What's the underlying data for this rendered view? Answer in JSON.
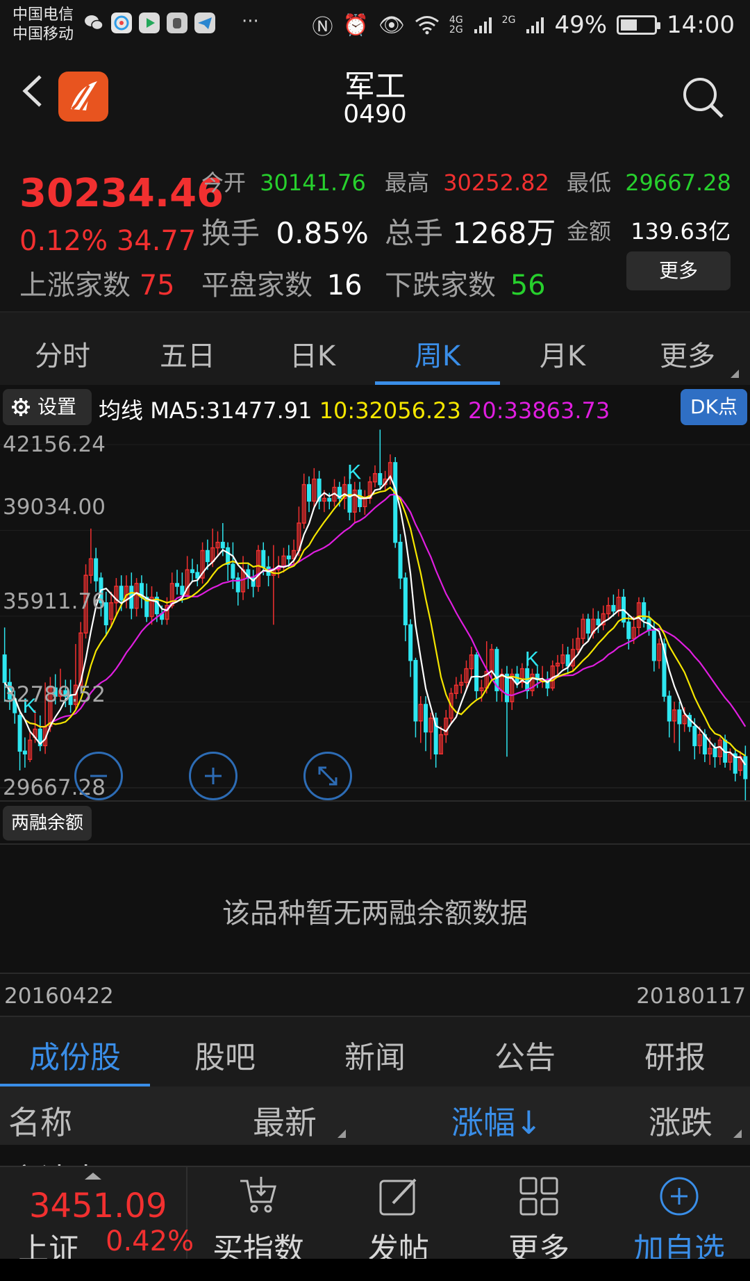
{
  "status_bar": {
    "carrier1": "中国电信",
    "carrier2": "中国移动",
    "net_label_1": "4G",
    "net_label_2": "2G",
    "net_label_3": "2G",
    "battery": "49%",
    "battery_level": 0.49,
    "time": "14:00",
    "more_dots": "···"
  },
  "header": {
    "title": "军工",
    "code": "0490"
  },
  "quote": {
    "price": "30234.46",
    "change_pct": "0.12%",
    "change_val": "34.77",
    "open_label": "今开",
    "open": "30141.76",
    "high_label": "最高",
    "high": "30252.82",
    "low_label": "最低",
    "low": "29667.28",
    "turnover_label": "换手",
    "turnover": "0.85%",
    "volume_label": "总手",
    "volume": "1268万",
    "amount_label": "金额",
    "amount": "139.63亿",
    "rising_label": "上涨家数",
    "rising": "75",
    "flat_label": "平盘家数",
    "flat": "16",
    "falling_label": "下跌家数",
    "falling": "56",
    "more_button": "更多"
  },
  "period_tabs": [
    "分时",
    "五日",
    "日K",
    "周K",
    "月K",
    "更多"
  ],
  "active_period": "周K",
  "ma_bar": {
    "settings": "设置",
    "ma_label": "均线",
    "ma5": "MA5:31477.91",
    "ma10": "10:32056.23",
    "ma20": "20:33863.73",
    "dk_button": "DK点"
  },
  "colors": {
    "up": "#f23030",
    "down": "#27d02d",
    "candle_down": "#2ee6f0",
    "ma5": "#ffffff",
    "ma10": "#f5e600",
    "ma20": "#e01ee0",
    "accent": "#3a8ee8"
  },
  "chart": {
    "y_labels": [
      "42156.24",
      "39034.00",
      "35911.76",
      "32789.52",
      "29667.28"
    ],
    "k_marker": "K",
    "signal_weeks": [
      3,
      67,
      102
    ],
    "candles": [
      [
        34500,
        33500,
        35500,
        32800
      ],
      [
        33500,
        32900,
        34000,
        32500
      ],
      [
        32900,
        32400,
        33200,
        32000
      ],
      [
        32300,
        31000,
        32500,
        30300
      ],
      [
        31000,
        30900,
        31500,
        30400
      ],
      [
        30700,
        31400,
        31700,
        30600
      ],
      [
        31500,
        31800,
        32500,
        31300
      ],
      [
        31800,
        31200,
        32300,
        31000
      ],
      [
        31200,
        31900,
        33500,
        30900
      ],
      [
        31900,
        33300,
        33700,
        31700
      ],
      [
        33300,
        33000,
        33800,
        32700
      ],
      [
        33000,
        33200,
        34000,
        32800
      ],
      [
        33200,
        33000,
        33600,
        32600
      ],
      [
        33000,
        32700,
        33600,
        32400
      ],
      [
        32700,
        33400,
        34900,
        32500
      ],
      [
        33400,
        35300,
        35700,
        33200
      ],
      [
        35300,
        37400,
        37800,
        35100
      ],
      [
        37400,
        38000,
        39100,
        37100
      ],
      [
        38000,
        37200,
        38400,
        36800
      ],
      [
        37300,
        36400,
        37500,
        35900
      ],
      [
        36400,
        35600,
        36800,
        35200
      ],
      [
        35800,
        36400,
        36800,
        35500
      ],
      [
        36400,
        37000,
        37300,
        35900
      ],
      [
        37000,
        36500,
        37400,
        36100
      ],
      [
        36500,
        37000,
        37400,
        36200
      ],
      [
        37000,
        36200,
        37500,
        35800
      ],
      [
        36200,
        37100,
        37300,
        35900
      ],
      [
        37100,
        36600,
        37400,
        36200
      ],
      [
        36600,
        35900,
        37100,
        35700
      ],
      [
        35900,
        36600,
        37000,
        35600
      ],
      [
        36600,
        36000,
        36800,
        35700
      ],
      [
        36000,
        35800,
        36300,
        35600
      ],
      [
        35800,
        36300,
        36600,
        35600
      ],
      [
        36300,
        37100,
        37500,
        36200
      ],
      [
        37100,
        37000,
        37600,
        36700
      ],
      [
        37000,
        36700,
        37500,
        36400
      ],
      [
        36700,
        37600,
        38100,
        36600
      ],
      [
        37600,
        37500,
        38000,
        37200
      ],
      [
        37500,
        37300,
        37800,
        37000
      ],
      [
        37300,
        38300,
        38600,
        37100
      ],
      [
        38300,
        37900,
        38700,
        37600
      ],
      [
        37900,
        38400,
        39100,
        37700
      ],
      [
        38400,
        38600,
        39000,
        38100
      ],
      [
        38600,
        38400,
        39300,
        38100
      ],
      [
        38400,
        37800,
        38600,
        37200
      ],
      [
        37800,
        37300,
        38600,
        36900
      ],
      [
        37300,
        36800,
        37500,
        36300
      ],
      [
        36800,
        37600,
        38100,
        36500
      ],
      [
        37600,
        37300,
        37800,
        36900
      ],
      [
        37300,
        37000,
        37600,
        36600
      ],
      [
        37000,
        38300,
        38500,
        36800
      ],
      [
        38300,
        37700,
        38600,
        37400
      ],
      [
        37700,
        37400,
        38100,
        37000
      ],
      [
        37400,
        37600,
        38500,
        35600
      ],
      [
        37600,
        37700,
        38100,
        37300
      ],
      [
        37700,
        38100,
        38400,
        37500
      ],
      [
        38100,
        38000,
        38500,
        37700
      ],
      [
        38000,
        38300,
        38700,
        37800
      ],
      [
        38300,
        39300,
        39900,
        38100
      ],
      [
        39300,
        40700,
        41100,
        39100
      ],
      [
        40700,
        40100,
        41000,
        39700
      ],
      [
        40100,
        40900,
        41300,
        39800
      ],
      [
        40900,
        40100,
        41200,
        39800
      ],
      [
        40100,
        40200,
        40500,
        39700
      ],
      [
        40200,
        40100,
        40400,
        39800
      ],
      [
        40100,
        40600,
        40900,
        39900
      ],
      [
        40600,
        40200,
        40800,
        39900
      ],
      [
        40200,
        40700,
        41000,
        39800
      ],
      [
        40700,
        39700,
        41000,
        39400
      ],
      [
        39700,
        40500,
        40800,
        39300
      ],
      [
        40500,
        39900,
        40800,
        39700
      ],
      [
        39900,
        40200,
        40500,
        39600
      ],
      [
        40200,
        40800,
        41000,
        40000
      ],
      [
        40800,
        41100,
        41400,
        40600
      ],
      [
        41100,
        40700,
        42700,
        40500
      ],
      [
        40700,
        40900,
        41200,
        40500
      ],
      [
        40900,
        41500,
        41800,
        40700
      ],
      [
        41500,
        38600,
        41700,
        38400
      ],
      [
        38600,
        37300,
        38900,
        36900
      ],
      [
        37300,
        35600,
        37500,
        35000
      ],
      [
        35600,
        34300,
        35800,
        33700
      ],
      [
        34300,
        32100,
        34400,
        31500
      ],
      [
        32100,
        32700,
        33000,
        31300
      ],
      [
        32700,
        31700,
        33000,
        31000
      ],
      [
        31700,
        32200,
        32400,
        30700
      ],
      [
        32200,
        30900,
        32400,
        30400
      ],
      [
        30900,
        31600,
        31900,
        30900
      ],
      [
        31600,
        32200,
        32500,
        31300
      ],
      [
        32200,
        33100,
        33300,
        32000
      ],
      [
        33100,
        33400,
        33700,
        32900
      ],
      [
        33400,
        33500,
        33800,
        33100
      ],
      [
        33500,
        34000,
        34300,
        33200
      ],
      [
        34000,
        34500,
        34800,
        33700
      ],
      [
        34500,
        33200,
        34600,
        32900
      ],
      [
        33200,
        33300,
        33600,
        32800
      ],
      [
        33300,
        33900,
        35000,
        33100
      ],
      [
        33900,
        34700,
        34900,
        33600
      ],
      [
        34700,
        33200,
        34800,
        32800
      ],
      [
        33200,
        33800,
        34000,
        32800
      ],
      [
        33800,
        32800,
        34100,
        30800
      ],
      [
        32800,
        33800,
        34000,
        32500
      ],
      [
        33800,
        33500,
        34100,
        33300
      ],
      [
        33500,
        34000,
        34200,
        33300
      ],
      [
        34000,
        33200,
        34400,
        32900
      ],
      [
        33200,
        33800,
        34000,
        33000
      ],
      [
        33800,
        33600,
        34100,
        33300
      ],
      [
        33600,
        33600,
        34100,
        33300
      ],
      [
        33600,
        33300,
        33900,
        33000
      ],
      [
        33300,
        34100,
        34300,
        33200
      ],
      [
        34100,
        34200,
        34500,
        33800
      ],
      [
        34200,
        34500,
        34900,
        34000
      ],
      [
        34500,
        34100,
        34800,
        33800
      ],
      [
        34100,
        34700,
        35100,
        33900
      ],
      [
        34700,
        35100,
        35500,
        34500
      ],
      [
        35100,
        35800,
        36000,
        34900
      ],
      [
        35800,
        35300,
        36000,
        35000
      ],
      [
        35300,
        35800,
        36200,
        35100
      ],
      [
        35800,
        35600,
        36100,
        35300
      ],
      [
        35600,
        36000,
        36300,
        35400
      ],
      [
        36000,
        36300,
        36600,
        35800
      ],
      [
        36300,
        36100,
        36700,
        35900
      ],
      [
        36100,
        36600,
        36900,
        35900
      ],
      [
        36600,
        35700,
        36900,
        35500
      ],
      [
        35700,
        35100,
        36000,
        34700
      ],
      [
        35100,
        35500,
        35900,
        34900
      ],
      [
        35500,
        36400,
        36600,
        35200
      ],
      [
        36400,
        35800,
        36600,
        35500
      ],
      [
        35800,
        35400,
        36100,
        35200
      ],
      [
        35400,
        34300,
        35700,
        33900
      ],
      [
        34300,
        34900,
        35100,
        34000
      ],
      [
        34900,
        33000,
        35100,
        32800
      ],
      [
        33000,
        32100,
        33200,
        31500
      ],
      [
        32100,
        32500,
        32800,
        31300
      ],
      [
        32500,
        32000,
        32800,
        31000
      ],
      [
        32000,
        32300,
        32600,
        31700
      ],
      [
        32300,
        31900,
        32400,
        31700
      ],
      [
        31900,
        31200,
        32200,
        30700
      ],
      [
        31200,
        31600,
        31900,
        30900
      ],
      [
        31600,
        30900,
        31800,
        30600
      ],
      [
        30900,
        31100,
        31500,
        30500
      ],
      [
        31100,
        30800,
        31300,
        30400
      ],
      [
        30800,
        31400,
        31500,
        30500
      ],
      [
        31400,
        30600,
        31600,
        30400
      ],
      [
        30600,
        30900,
        31100,
        30300
      ],
      [
        30900,
        30200,
        31100,
        29900
      ],
      [
        30300,
        30800,
        31000,
        30100
      ],
      [
        30800,
        30000,
        31200,
        29200
      ]
    ]
  },
  "margin": {
    "tag": "两融余额",
    "empty_text": "该品种暂无两融余额数据",
    "date_start": "20160422",
    "date_end": "20180117"
  },
  "content_tabs": [
    "成份股",
    "股吧",
    "新闻",
    "公告",
    "研报"
  ],
  "active_content_tab": "成份股",
  "list_header": {
    "name": "名称",
    "latest": "最新",
    "pct": "涨幅↓",
    "change": "涨跌"
  },
  "list_peek": "宇达电子",
  "bottom_bar": {
    "index_value": "3451.09",
    "index_name": "上证",
    "index_pct": "0.42%",
    "buy_index": "买指数",
    "post": "发帖",
    "more": "更多",
    "add_watch": "加自选"
  },
  "icons": [
    "back-icon",
    "app-logo-icon",
    "search-icon",
    "gear-icon",
    "zoom-out-icon",
    "zoom-in-icon",
    "expand-icon",
    "cart-icon",
    "edit-icon",
    "grid-icon",
    "plus-circle-icon"
  ]
}
